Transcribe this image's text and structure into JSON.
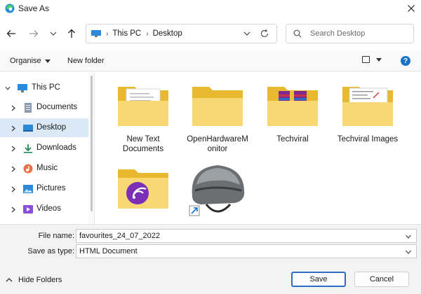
{
  "window": {
    "title": "Save As",
    "app_icon": "edge-browser-icon",
    "close_icon": "close-icon"
  },
  "nav": {
    "back_icon": "arrow-left-icon",
    "forward_icon": "arrow-right-icon",
    "recent_icon": "chevron-down-icon",
    "up_icon": "arrow-up-icon",
    "breadcrumb": [
      "This PC",
      "Desktop"
    ],
    "search_placeholder": "Search Desktop"
  },
  "toolbar": {
    "organise": "Organise",
    "new_folder": "New folder",
    "help": "?"
  },
  "sidebar": {
    "items": [
      {
        "label": "This PC",
        "icon": "monitor-icon",
        "expanded": true
      },
      {
        "label": "Documents",
        "icon": "document-icon"
      },
      {
        "label": "Desktop",
        "icon": "desktop-icon",
        "selected": true
      },
      {
        "label": "Downloads",
        "icon": "download-icon"
      },
      {
        "label": "Music",
        "icon": "music-icon"
      },
      {
        "label": "Pictures",
        "icon": "pictures-icon"
      },
      {
        "label": "Videos",
        "icon": "videos-icon"
      }
    ]
  },
  "files": [
    {
      "name": "New Text\nDocuments",
      "kind": "folder-with-documents"
    },
    {
      "name": "OpenHardwareM\nonitor",
      "kind": "folder"
    },
    {
      "name": "Techviral",
      "kind": "folder-with-books"
    },
    {
      "name": "Techviral Images",
      "kind": "folder-with-screenshot"
    },
    {
      "name": "",
      "kind": "folder-with-podcast"
    },
    {
      "name": "",
      "kind": "helmet-shortcut"
    }
  ],
  "form": {
    "file_name_label": "File name:",
    "file_name_value": "favourites_24_07_2022",
    "save_type_label": "Save as type:",
    "save_type_value": "HTML Document"
  },
  "footer": {
    "hide_folders": "Hide Folders",
    "save": "Save",
    "cancel": "Cancel"
  },
  "colors": {
    "folder": "#f8d775",
    "folder_back": "#e8b92e",
    "accent": "#2b6cc4",
    "selection": "#dbe9f7"
  }
}
